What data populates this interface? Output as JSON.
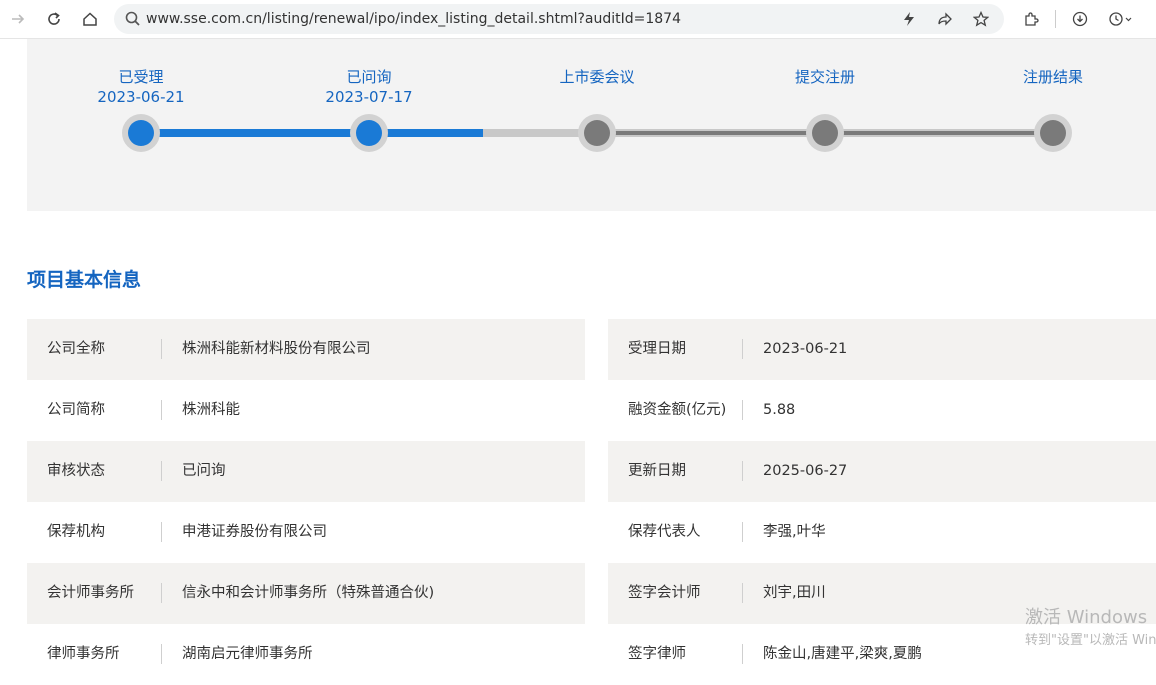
{
  "browser": {
    "url": "www.sse.com.cn/listing/renewal/ipo/index_listing_detail.shtml?auditId=1874",
    "icons": [
      "forward-icon",
      "reload-icon",
      "home-icon",
      "search-icon",
      "lightning-icon",
      "share-icon",
      "star-icon",
      "extensions-icon",
      "download-icon",
      "history-icon"
    ]
  },
  "progress": {
    "steps": [
      {
        "label": "已受理",
        "date": "2023-06-21",
        "status": "done"
      },
      {
        "label": "已问询",
        "date": "2023-07-17",
        "status": "done"
      },
      {
        "label": "上市委会议",
        "date": "",
        "status": "pending"
      },
      {
        "label": "提交注册",
        "date": "",
        "status": "pending"
      },
      {
        "label": "注册结果",
        "date": "",
        "status": "pending"
      }
    ],
    "active_color": "#1a7ad6",
    "inactive_color": "#7a7a7a"
  },
  "section": {
    "title": "项目基本信息"
  },
  "info": {
    "left": [
      {
        "label": "公司全称",
        "value": "株洲科能新材料股份有限公司"
      },
      {
        "label": "公司简称",
        "value": "株洲科能"
      },
      {
        "label": "审核状态",
        "value": "已问询"
      },
      {
        "label": "保荐机构",
        "value": "申港证券股份有限公司"
      },
      {
        "label": "会计师事务所",
        "value": "信永中和会计师事务所（特殊普通合伙)"
      },
      {
        "label": "律师事务所",
        "value": "湖南启元律师事务所"
      }
    ],
    "right": [
      {
        "label": "受理日期",
        "value": "2023-06-21"
      },
      {
        "label": "融资金额(亿元)",
        "value": "5.88"
      },
      {
        "label": "更新日期",
        "value": "2025-06-27"
      },
      {
        "label": "保荐代表人",
        "value": "李强,叶华"
      },
      {
        "label": "签字会计师",
        "value": "刘宇,田川"
      },
      {
        "label": "签字律师",
        "value": "陈金山,唐建平,梁爽,夏鹏"
      }
    ]
  },
  "watermark": {
    "line1": "激活 Windows",
    "line2": "转到\"设置\"以激活 Windows。"
  }
}
